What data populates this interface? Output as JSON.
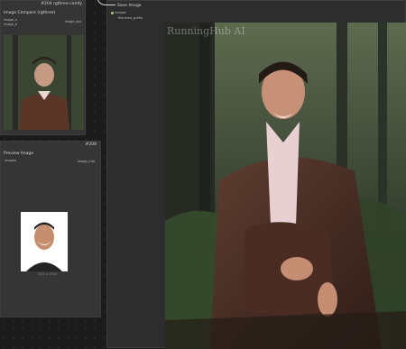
{
  "left_node_top": {
    "title": "Image Compare (rgthree)",
    "badge": "#204 rgthree-comfy",
    "input_a": "image_a",
    "input_b": "image_b",
    "select_value": "image_opt"
  },
  "left_node_bottom": {
    "badge": "#208",
    "title": "Preview Image",
    "input_images": "images",
    "output_label": "image_info",
    "thumb_caption": "1024 x 1024"
  },
  "save_node": {
    "title": "Save Image",
    "input_images": "images",
    "filename_prefix_label": "filename_prefix"
  },
  "main_image": {
    "watermark": "RunningHub AI"
  },
  "colors": {
    "canvas": "#1b1b1b",
    "node_bg": "#353535",
    "link": "#9ad27a"
  }
}
